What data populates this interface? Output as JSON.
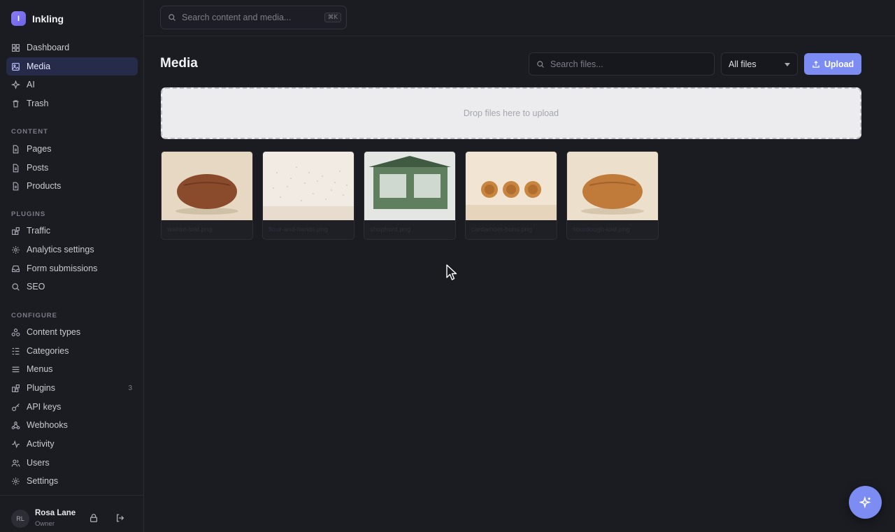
{
  "brand": {
    "logo_letter": "I",
    "name": "Inkling"
  },
  "sidebar": {
    "main": [
      {
        "label": "Dashboard",
        "icon": "grid-icon"
      },
      {
        "label": "Media",
        "icon": "image-icon",
        "active": true
      },
      {
        "label": "AI",
        "icon": "sparkle-icon"
      },
      {
        "label": "Trash",
        "icon": "trash-icon"
      }
    ],
    "content_label": "CONTENT",
    "content": [
      {
        "label": "Pages",
        "icon": "document-icon"
      },
      {
        "label": "Posts",
        "icon": "document-icon"
      },
      {
        "label": "Products",
        "icon": "document-icon"
      }
    ],
    "plugins_label": "PLUGINS",
    "plugins": [
      {
        "label": "Traffic",
        "icon": "puzzle-icon"
      },
      {
        "label": "Analytics settings",
        "icon": "gear-icon"
      },
      {
        "label": "Form submissions",
        "icon": "inbox-icon"
      },
      {
        "label": "SEO",
        "icon": "search-icon"
      }
    ],
    "configure_label": "CONFIGURE",
    "configure": [
      {
        "label": "Content types",
        "icon": "shapes-icon"
      },
      {
        "label": "Categories",
        "icon": "list-tree-icon"
      },
      {
        "label": "Menus",
        "icon": "menu-icon"
      },
      {
        "label": "Plugins",
        "icon": "puzzle-icon",
        "badge": "3"
      },
      {
        "label": "API keys",
        "icon": "key-icon"
      },
      {
        "label": "Webhooks",
        "icon": "webhook-icon"
      },
      {
        "label": "Activity",
        "icon": "activity-icon"
      },
      {
        "label": "Users",
        "icon": "users-icon"
      },
      {
        "label": "Settings",
        "icon": "gear-icon"
      }
    ]
  },
  "user": {
    "initials": "RL",
    "name": "Rosa Lane",
    "role": "Owner"
  },
  "topbar": {
    "search_placeholder": "Search content and media...",
    "shortcut": "⌘K"
  },
  "main": {
    "title": "Media",
    "file_search_placeholder": "Search files...",
    "filter_value": "All files",
    "upload_label": "Upload",
    "dropzone_text": "Drop files here to upload",
    "files": [
      {
        "name": "walnut-loaf.png",
        "thumb": "loaf"
      },
      {
        "name": "flour-and-hands.png",
        "thumb": "flour"
      },
      {
        "name": "shopfront.png",
        "thumb": "shop"
      },
      {
        "name": "cardamom-buns.png",
        "thumb": "buns"
      },
      {
        "name": "sourdough-loaf.png",
        "thumb": "loaf2"
      }
    ]
  },
  "colors": {
    "accent": "#7c8cf2",
    "active_bg": "#262b4a",
    "background": "#1b1c22"
  }
}
